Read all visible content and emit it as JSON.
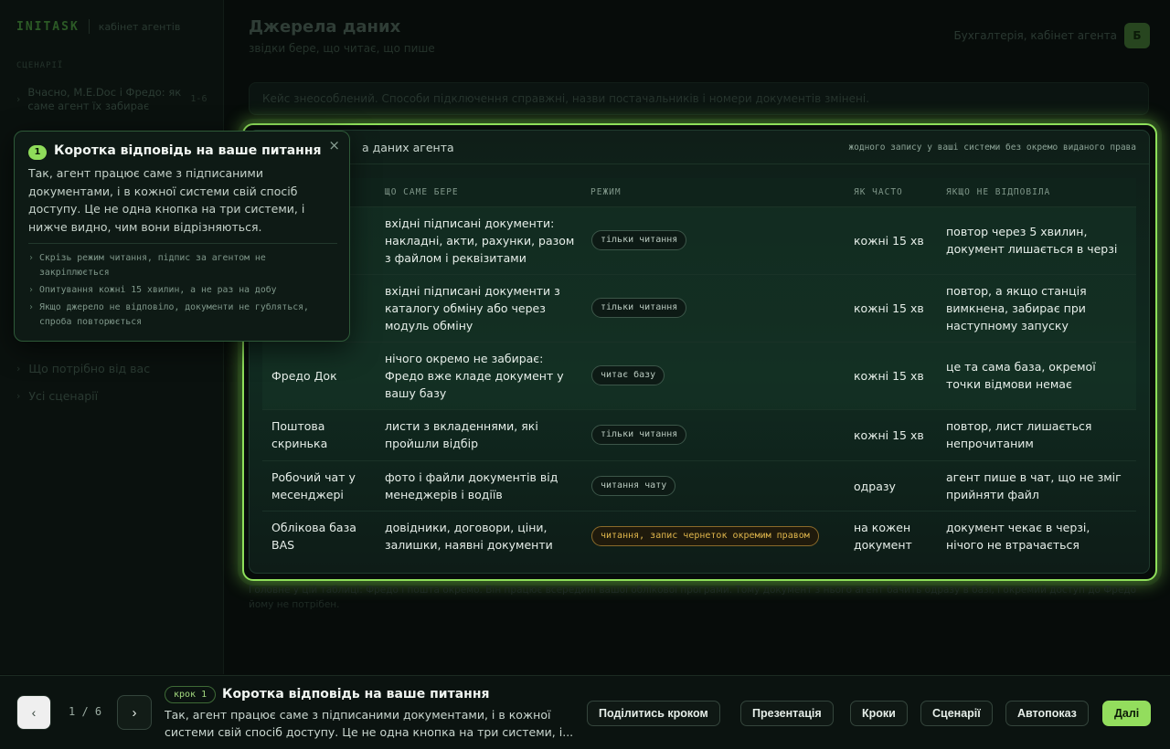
{
  "sidebar": {
    "logo": "INITASK",
    "subtitle": "кабінет агентів",
    "section_label": "СЦЕНАРІЇ",
    "scenario": {
      "label": "Вчасно, M.E.Doc і Фредо: як саме агент їх забирає",
      "count": "1-6"
    },
    "links": [
      "Що потрібно від вас",
      "Усі сценарії"
    ]
  },
  "header": {
    "title": "Джерела даних",
    "subtitle": "звідки бере, що читає, що пише",
    "breadcrumb": "Бухгалтерія, кабінет агента",
    "avatar": "Б"
  },
  "notice": "Кейс знеособлений. Способи підключення справжні, назви постачальників і номери документів змінені.",
  "card": {
    "title_fragment": "а даних агента",
    "note": "жодного запису у ваші системи без окремо виданого права",
    "columns": [
      "ЩО САМЕ БЕРЕ",
      "РЕЖИМ",
      "ЯК ЧАСТО",
      "ЯКЩО НЕ ВІДПОВІЛА"
    ],
    "rows": [
      {
        "source": "",
        "takes": "вхідні підписані документи: накладні, акти, рахунки, разом з файлом і реквізитами",
        "mode": "тільки читання",
        "freq": "кожні 15 хв",
        "fail": "повтор через 5 хвилин, документ лишається в черзі"
      },
      {
        "source": "",
        "takes": "вхідні підписані документи з каталогу обміну або через модуль обміну",
        "mode": "тільки читання",
        "freq": "кожні 15 хв",
        "fail": "повтор, а якщо станція вимкнена, забирає при наступному запуску"
      },
      {
        "source": "Фредо Док",
        "takes": "нічого окремо не забирає: Фредо вже кладе документ у вашу базу",
        "mode": "читає базу",
        "freq": "кожні 15 хв",
        "fail": "це та сама база, окремої точки відмови немає"
      },
      {
        "source": "Поштова скринька",
        "takes": "листи з вкладеннями, які пройшли відбір",
        "mode": "тільки читання",
        "freq": "кожні 15 хв",
        "fail": "повтор, лист лишається непрочитаним"
      },
      {
        "source": "Робочий чат у месенджері",
        "takes": "фото і файли документів від менеджерів і водіїв",
        "mode": "читання чату",
        "freq": "одразу",
        "fail": "агент пише в чат, що не зміг прийняти файл"
      },
      {
        "source": "Облікова база BAS",
        "takes": "довідники, договори, ціни, залишки, наявні документи",
        "mode": "читання, запис чернеток окремим правом",
        "freq": "на кожен документ",
        "fail": "документ чекає в черзі, нічого не втрачається"
      }
    ]
  },
  "footnote": "Головне у цій таблиці: Фредо і пошта окремо. Він працює всередині вашої облікової програми. Тому документ з нього агент бачить одразу в базі, і окремий доступ до Фредо йому не потрібен.",
  "popover": {
    "number": "1",
    "title": "Коротка відповідь на ваше питання",
    "body": "Так, агент працює саме з підписаними документами, і в кожної системи свій спосіб доступу. Це не одна кнопка на три системи, і нижче видно, чим вони відрізняються.",
    "close": "×",
    "points": [
      "Скрізь режим читання, підпис за агентом не закріплюється",
      "Опитування кожні 15 хвилин, а не раз на добу",
      "Якщо джерело не відповіло, документи не губляться, спроба повторюється"
    ]
  },
  "bottom_bar": {
    "prev": "‹",
    "next": "›",
    "counter": "1 / 6",
    "step_badge": "крок 1",
    "step_title": "Коротка відповідь на ваше питання",
    "step_text": "Так, агент працює саме з підписаними документами, і в кожної системи свій спосіб доступу. Це не одна кнопка на три системи, і...",
    "buttons": {
      "share": "Поділитись кроком",
      "presentation": "Презентація",
      "steps": "Кроки",
      "scenarios": "Сценарії",
      "autoplay": "Автопоказ",
      "next": "Далі"
    }
  },
  "colors": {
    "accent": "#93dd5d",
    "warn": "#e0b64c"
  }
}
